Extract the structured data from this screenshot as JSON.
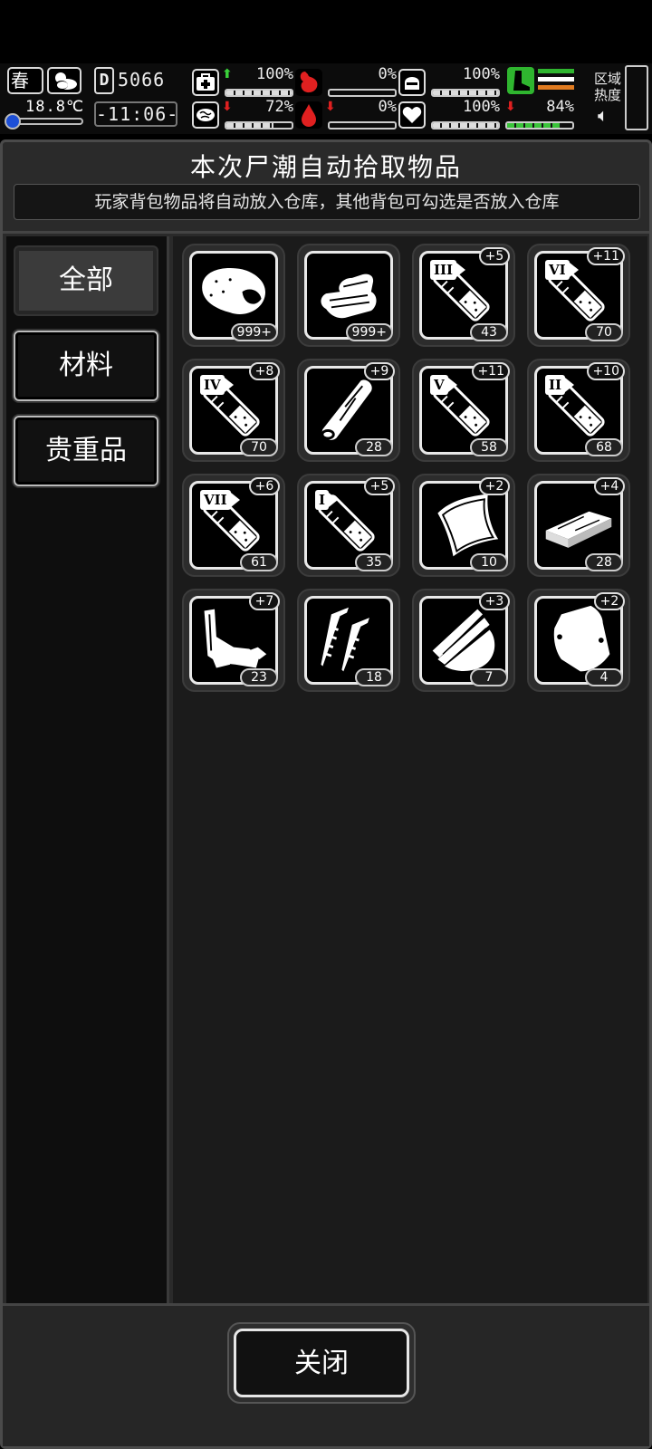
{
  "status": {
    "season": "春",
    "temperature": "18.8℃",
    "day_label": "D",
    "day_number": "5066",
    "clock": "-11:06-",
    "health": {
      "value": "100%",
      "trend": "up"
    },
    "hunger": {
      "value": "0%"
    },
    "armor": {
      "value": "100%"
    },
    "stamina": {
      "value": "72%",
      "trend": "down"
    },
    "thirst": {
      "value": "0%",
      "trend": "down"
    },
    "mood": {
      "value": "100%"
    },
    "energy": {
      "value": "84%",
      "trend": "down"
    },
    "region_label_1": "区域",
    "region_label_2": "热度"
  },
  "panel": {
    "title": "本次尸潮自动拾取物品",
    "subtitle": "玩家背包物品将自动放入仓库，其他背包可勾选是否放入仓库"
  },
  "tabs": [
    {
      "label": "全部",
      "active": true
    },
    {
      "label": "材料",
      "active": false
    },
    {
      "label": "贵重品",
      "active": false
    }
  ],
  "items": [
    {
      "icon": "meat-icon",
      "count": "999+",
      "plus": ""
    },
    {
      "icon": "cloth-icon",
      "count": "999+",
      "plus": ""
    },
    {
      "icon": "syringe-icon",
      "roman": "III",
      "count": "43",
      "plus": "+5"
    },
    {
      "icon": "syringe-icon",
      "roman": "VI",
      "count": "70",
      "plus": "+11"
    },
    {
      "icon": "syringe-icon",
      "roman": "IV",
      "count": "70",
      "plus": "+8"
    },
    {
      "icon": "wood-log-icon",
      "count": "28",
      "plus": "+9"
    },
    {
      "icon": "syringe-icon",
      "roman": "V",
      "count": "58",
      "plus": "+11"
    },
    {
      "icon": "syringe-icon",
      "roman": "II",
      "count": "68",
      "plus": "+10"
    },
    {
      "icon": "syringe-icon",
      "roman": "VII",
      "count": "61",
      "plus": "+6"
    },
    {
      "icon": "syringe-icon",
      "roman": "I",
      "count": "35",
      "plus": "+5"
    },
    {
      "icon": "leather-icon",
      "count": "10",
      "plus": "+2"
    },
    {
      "icon": "plank-icon",
      "count": "28",
      "plus": "+4"
    },
    {
      "icon": "scrap-metal-icon",
      "count": "23",
      "plus": "+7"
    },
    {
      "icon": "nails-icon",
      "count": "18",
      "plus": ""
    },
    {
      "icon": "wood-shards-icon",
      "count": "7",
      "plus": "+3"
    },
    {
      "icon": "plastic-bag-icon",
      "count": "4",
      "plus": "+2"
    }
  ],
  "footer": {
    "close_label": "关闭"
  }
}
